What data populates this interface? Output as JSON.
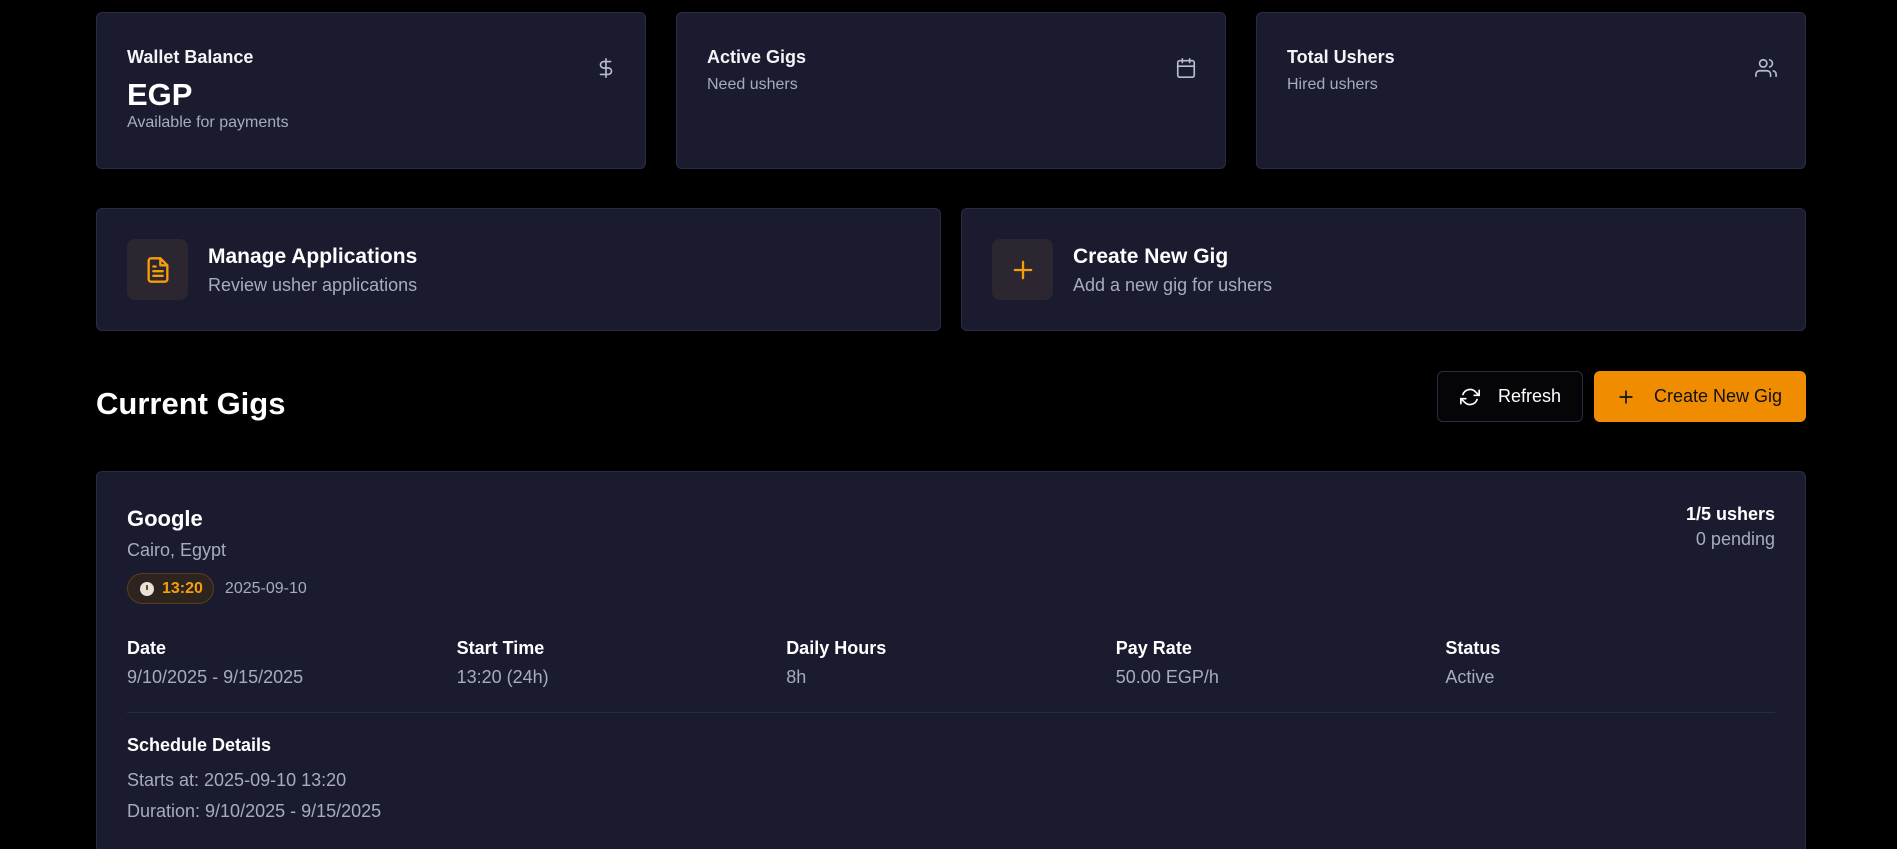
{
  "stats": {
    "wallet": {
      "title": "Wallet Balance",
      "value": "EGP",
      "sub": "Available for payments",
      "icon": "dollar-icon"
    },
    "active_gigs": {
      "title": "Active Gigs",
      "sub": "Need ushers",
      "icon": "calendar-icon"
    },
    "total_ushers": {
      "title": "Total Ushers",
      "sub": "Hired ushers",
      "icon": "users-icon"
    }
  },
  "actions": {
    "manage": {
      "title": "Manage Applications",
      "sub": "Review usher applications",
      "icon": "document-icon"
    },
    "create": {
      "title": "Create New Gig",
      "sub": "Add a new gig for ushers",
      "icon": "plus-icon"
    }
  },
  "section": {
    "title": "Current Gigs",
    "refresh_label": "Refresh",
    "create_label": "Create New Gig"
  },
  "gig": {
    "name": "Google",
    "location": "Cairo, Egypt",
    "time_badge": "13:20",
    "date": "2025-09-10",
    "ushers": "1/5 ushers",
    "pending": "0 pending",
    "info": [
      {
        "label": "Date",
        "value": "9/10/2025 - 9/15/2025"
      },
      {
        "label": "Start Time",
        "value": "13:20 (24h)"
      },
      {
        "label": "Daily Hours",
        "value": "8h"
      },
      {
        "label": "Pay Rate",
        "value": "50.00 EGP/h"
      },
      {
        "label": "Status",
        "value": "Active"
      }
    ],
    "schedule": {
      "title": "Schedule Details",
      "starts": "Starts at: 2025-09-10 13:20",
      "duration": "Duration: 9/10/2025 - 9/15/2025"
    }
  },
  "colors": {
    "accent": "#f08c00",
    "card": "#1a1b2f",
    "background": "#000000"
  }
}
